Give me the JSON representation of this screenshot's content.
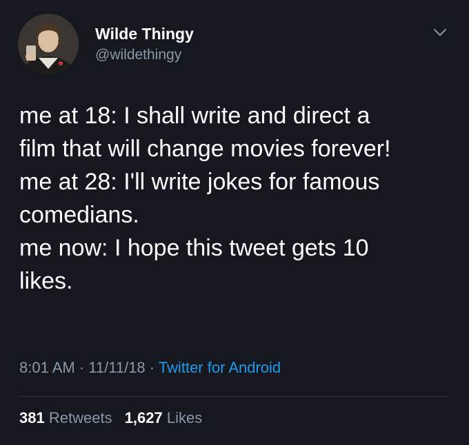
{
  "author": {
    "display_name": "Wilde Thingy",
    "handle": "@wildethingy",
    "avatar_icon": "profile-photo"
  },
  "tweet": {
    "lines": [
      "me at 18: I shall write and direct a",
      "film that will change movies forever!",
      "me at 28: I'll write jokes for famous",
      "comedians.",
      "me now: I hope this tweet gets 10",
      "likes."
    ]
  },
  "meta": {
    "time": "8:01 AM",
    "separator": "·",
    "date": "11/11/18",
    "source": "Twitter for Android"
  },
  "stats": {
    "retweets_count": "381",
    "retweets_label": "Retweets",
    "likes_count": "1,627",
    "likes_label": "Likes"
  },
  "colors": {
    "background": "#15181f",
    "primary_text": "#ffffff",
    "secondary_text": "#8b98a5",
    "link": "#1d9bf0"
  }
}
